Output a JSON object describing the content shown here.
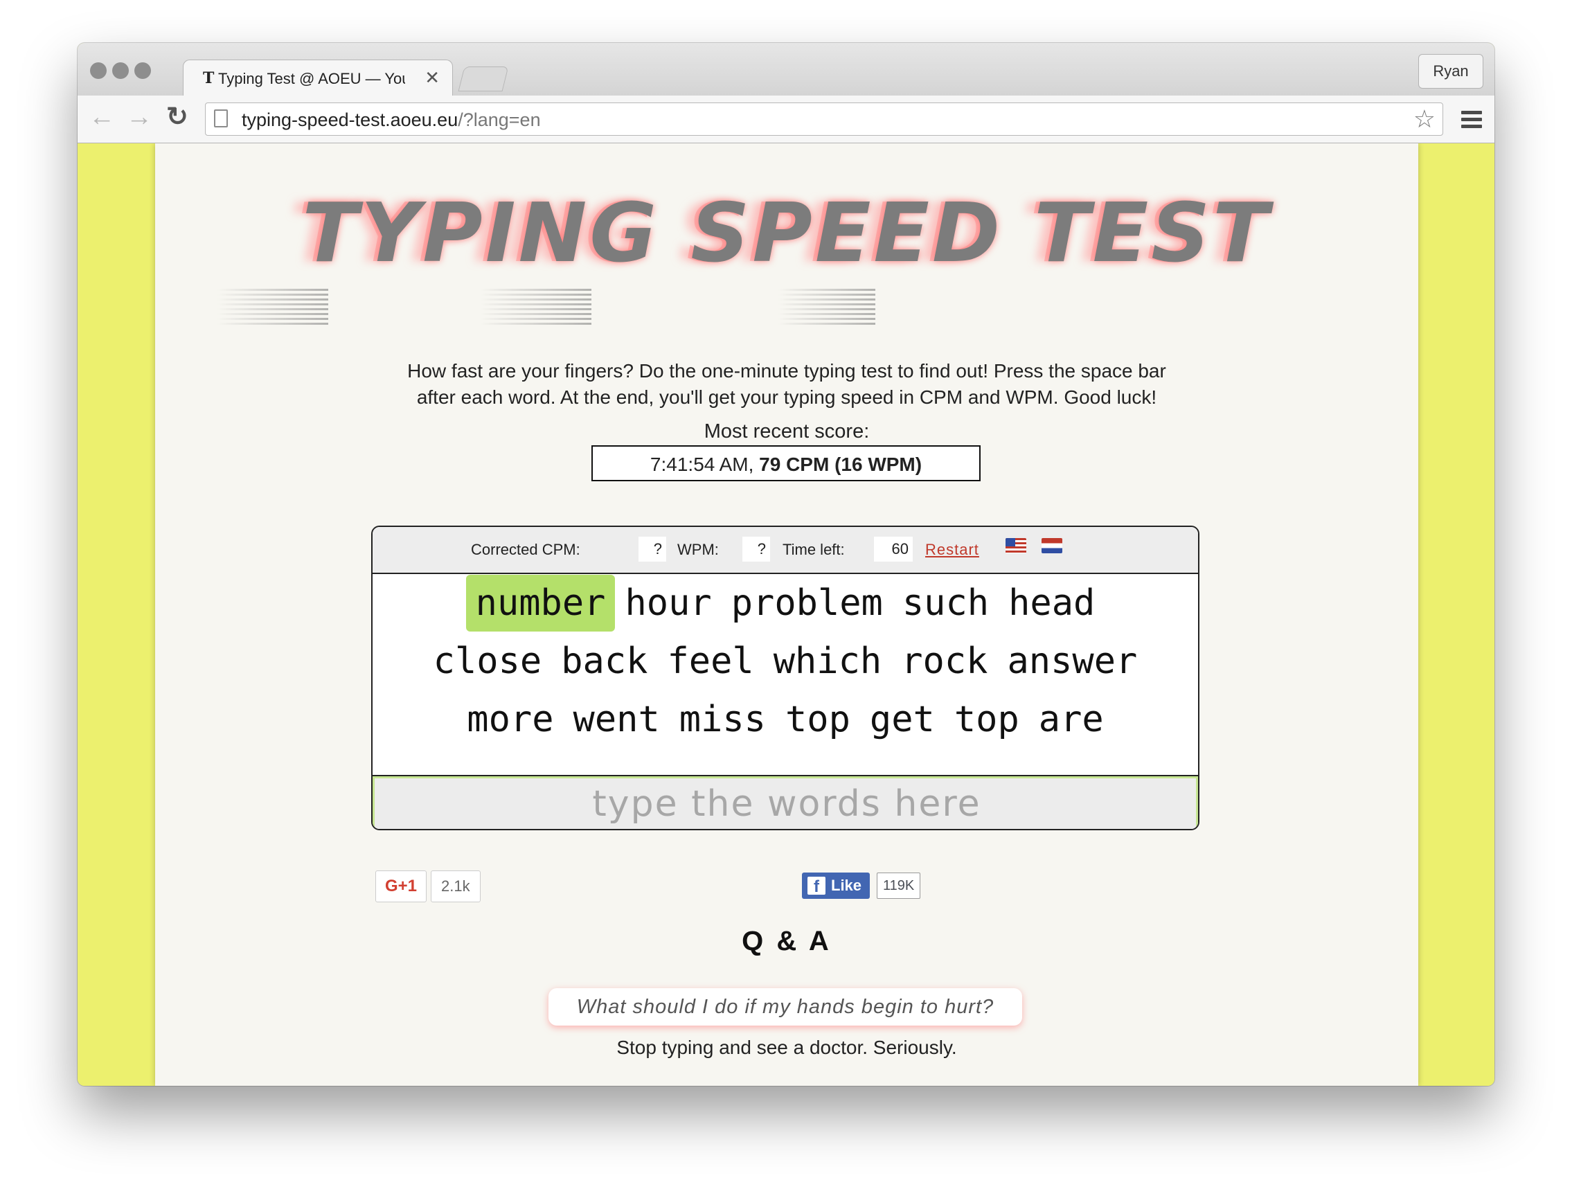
{
  "browser": {
    "tab_title": "Typing Test @ AOEU — You",
    "tab_favicon": "T",
    "tab_close": "✕",
    "profile_name": "Ryan",
    "url_domain": "typing-speed-test.aoeu.eu",
    "url_path": "/?lang=en"
  },
  "page": {
    "logo_text": "TYPING SPEED TEST",
    "intro_line1": "How fast are your fingers? Do the one-minute typing test to find out! Press the space bar",
    "intro_line2": "after each word. At the end, you'll get your typing speed in CPM and WPM. Good luck!",
    "recent_label": "Most recent score:",
    "recent_time": "7:41:54 AM,",
    "recent_score": "79 CPM (16 WPM)"
  },
  "test": {
    "corrected_cpm_label": "Corrected CPM:",
    "corrected_cpm_value": "?",
    "wpm_label": "WPM:",
    "wpm_value": "?",
    "time_left_label": "Time left:",
    "time_left_value": "60",
    "restart_label": "Restart",
    "flags": [
      "us-flag-icon",
      "nl-flag-icon"
    ],
    "lines": [
      [
        "number",
        "hour",
        "problem",
        "such",
        "head"
      ],
      [
        "close",
        "back",
        "feel",
        "which",
        "rock",
        "answer"
      ],
      [
        "more",
        "went",
        "miss",
        "top",
        "get",
        "top",
        "are"
      ]
    ],
    "current_word": "number",
    "current_word_color": "#b4e06a",
    "input_placeholder": "type the words here"
  },
  "social": {
    "gplus_label": "G+1",
    "gplus_count": "2.1k",
    "fb_label": "Like",
    "fb_count": "119K"
  },
  "qa": {
    "title": "Q & A",
    "question": "What should I do if my hands begin to hurt?",
    "answer": "Stop typing and see a doctor. Seriously."
  },
  "colors": {
    "side_background": "#ecf06e",
    "page_background": "#f7f6f1",
    "restart_link": "#c0392b",
    "facebook_blue": "#4266b2"
  }
}
